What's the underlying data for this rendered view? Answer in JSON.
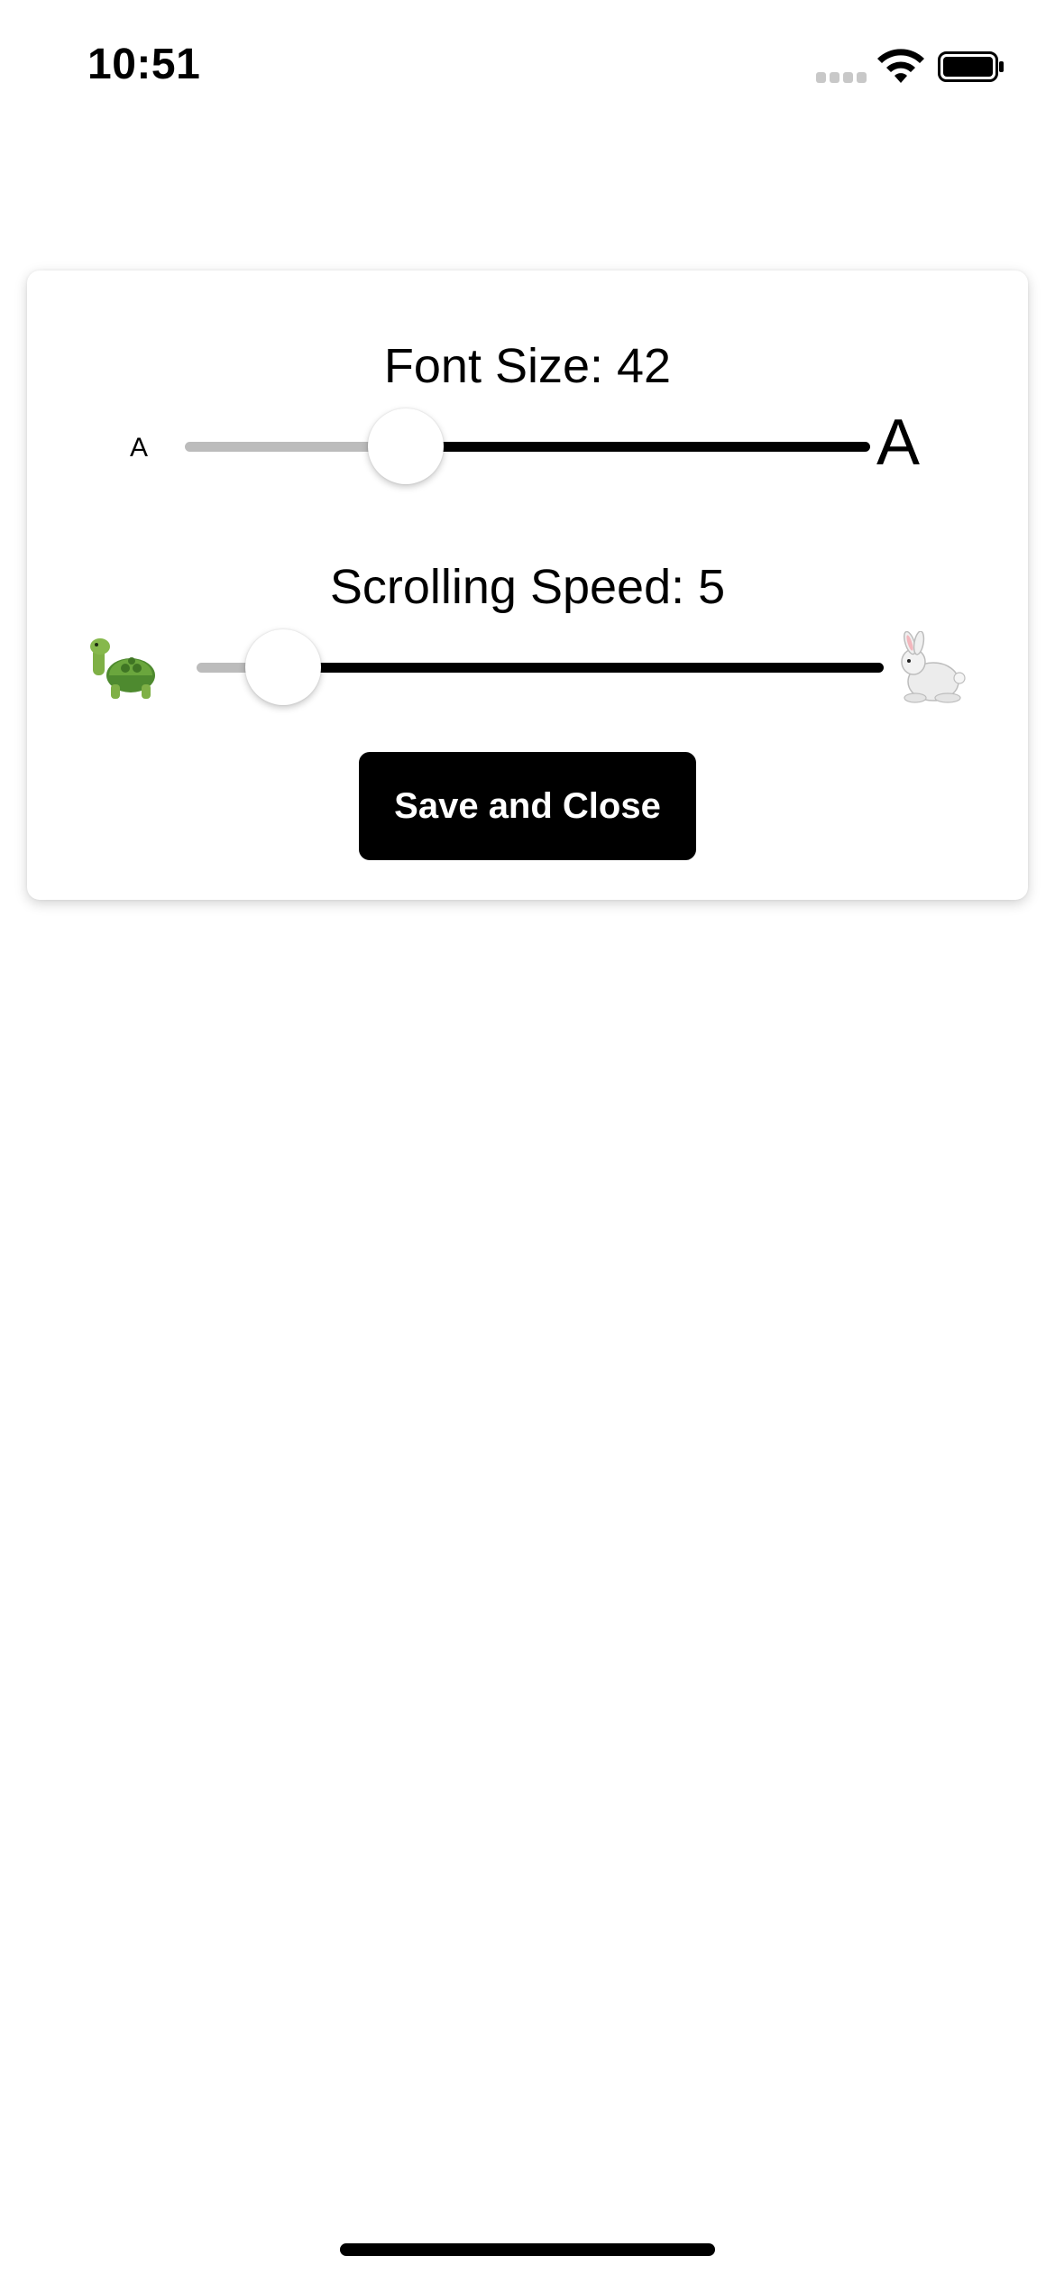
{
  "status_bar": {
    "time": "10:51"
  },
  "settings": {
    "font_size_label": "Font Size: 42",
    "font_small_glyph": "A",
    "font_large_glyph": "A",
    "font_slider_fraction": 0.3,
    "speed_label": "Scrolling Speed: 5",
    "speed_slider_fraction": 0.08,
    "slow_icon": "turtle-icon",
    "fast_icon": "rabbit-icon",
    "save_label": "Save and Close"
  },
  "colors": {
    "accent": "#000000",
    "track_min": "#bcbcbc",
    "background": "#ffffff"
  }
}
